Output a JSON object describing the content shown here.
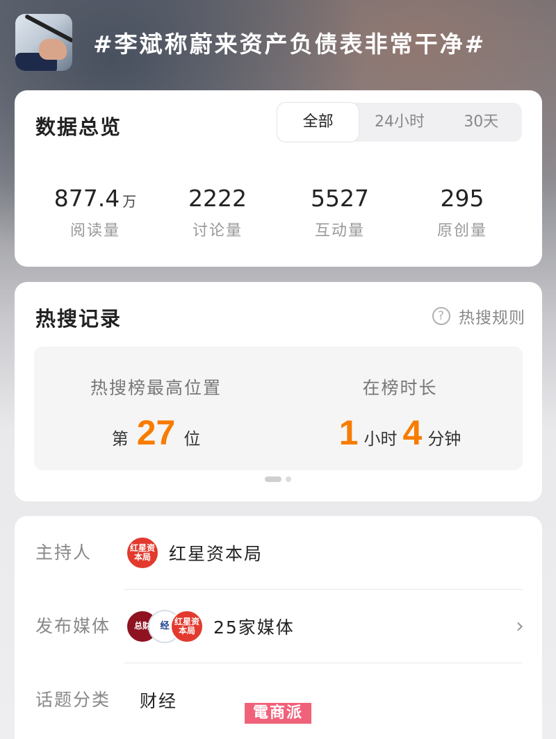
{
  "header": {
    "title": "#李斌称蔚来资产负债表非常干净#",
    "thumbnail_icon": "microphone-hand-icon"
  },
  "overview": {
    "title": "数据总览",
    "tabs": [
      {
        "label": "全部",
        "active": true
      },
      {
        "label": "24小时",
        "active": false
      },
      {
        "label": "30天",
        "active": false
      }
    ],
    "stats": [
      {
        "value": "877.4",
        "unit": "万",
        "label": "阅读量"
      },
      {
        "value": "2222",
        "unit": "",
        "label": "讨论量"
      },
      {
        "value": "5527",
        "unit": "",
        "label": "互动量"
      },
      {
        "value": "295",
        "unit": "",
        "label": "原创量"
      }
    ]
  },
  "hot_search": {
    "title": "热搜记录",
    "rules_label": "热搜规则",
    "rules_icon": "question-circle-icon",
    "max_position": {
      "label": "热搜榜最高位置",
      "prefix": "第",
      "value": "27",
      "suffix": "位"
    },
    "duration": {
      "label": "在榜时长",
      "hours": "1",
      "hours_unit": "小时",
      "minutes": "4",
      "minutes_unit": "分钟"
    },
    "accent_color": "#f77c00"
  },
  "info": {
    "host": {
      "label": "主持人",
      "avatar_text": "红星资本局",
      "name": "红星资本局"
    },
    "media": {
      "label": "发布媒体",
      "avatars": [
        "总财",
        "经",
        "红星资本局"
      ],
      "text": "25家媒体"
    },
    "category": {
      "label": "话题分类",
      "value": "财经"
    }
  },
  "watermark": "電商派"
}
